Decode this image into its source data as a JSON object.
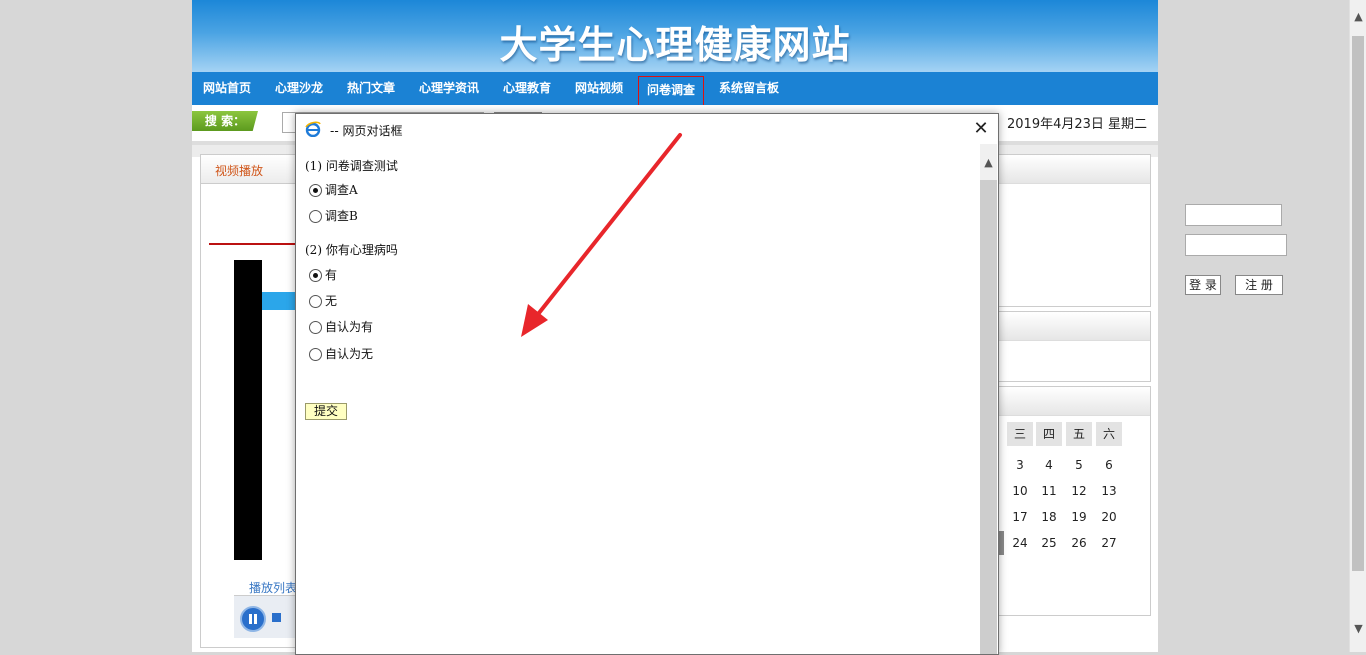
{
  "site": {
    "title": "大学生心理健康网站",
    "date": "2019年4月23日 星期二"
  },
  "nav": {
    "items": [
      "网站首页",
      "心理沙龙",
      "热门文章",
      "心理学资讯",
      "心理教育",
      "网站视频",
      "问卷调查",
      "系统留言板"
    ],
    "active": "问卷调查"
  },
  "search": {
    "label": "搜 索："
  },
  "left_panel": {
    "title": "视频播放",
    "playlist_label": "播放列表"
  },
  "login": {
    "login_button": "登 录",
    "register_button": "注 册"
  },
  "calendar": {
    "visible_headers": [
      "三",
      "四",
      "五",
      "六"
    ],
    "rows": [
      [
        "3",
        "4",
        "5",
        "6"
      ],
      [
        "10",
        "11",
        "12",
        "13"
      ],
      [
        "17",
        "18",
        "19",
        "20"
      ],
      [
        "24",
        "25",
        "26",
        "27"
      ]
    ]
  },
  "dialog": {
    "title": "-- 网页对话框",
    "questions": [
      {
        "title": "(1) 问卷调查测试",
        "options": [
          "调查A",
          "调查B"
        ],
        "selected": 0
      },
      {
        "title": "(2) 你有心理病吗",
        "options": [
          "有",
          "无",
          "自认为有",
          "自认为无"
        ],
        "selected": 0
      }
    ],
    "submit_label": "提交"
  },
  "colors": {
    "banner_top": "#1c87d8",
    "nav_bg": "#1b82d4",
    "search_label_bg": "#6aab27",
    "accent_orange": "#d0561a",
    "annotation_arrow": "#e8262b",
    "submit_bg": "#ffffc2"
  }
}
